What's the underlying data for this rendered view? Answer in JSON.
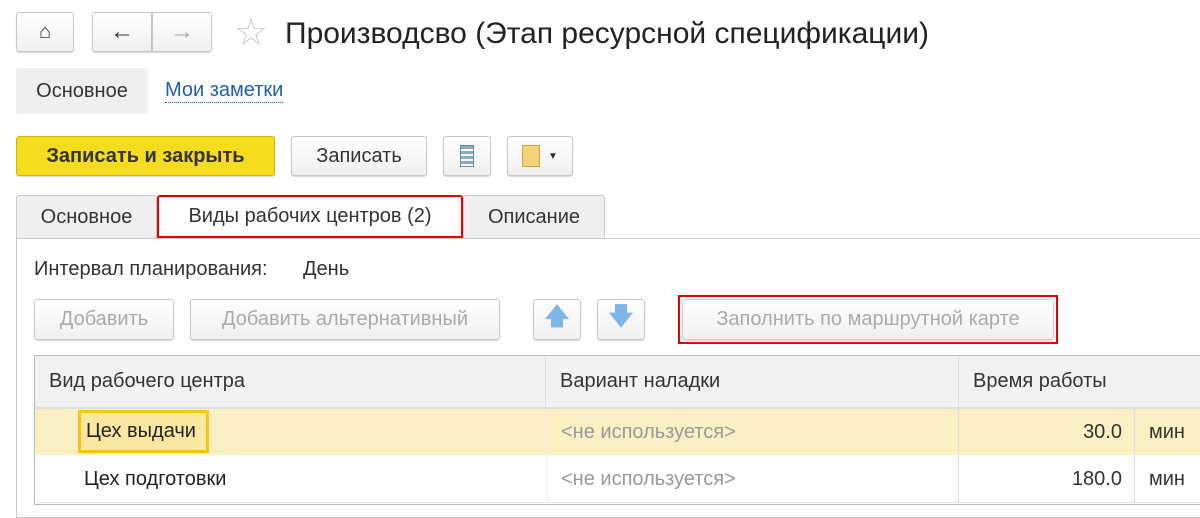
{
  "header": {
    "title": "Производсво (Этап ресурсной спецификации)"
  },
  "nav": {
    "main": "Основное",
    "notes": "Мои заметки"
  },
  "toolbar": {
    "save_close": "Записать и закрыть",
    "save": "Записать"
  },
  "tabs": [
    {
      "label": "Основное"
    },
    {
      "label": "Виды рабочих центров (2)"
    },
    {
      "label": "Описание"
    }
  ],
  "panel": {
    "interval_label": "Интервал планирования:",
    "interval_value": "День",
    "add": "Добавить",
    "add_alt": "Добавить альтернативный",
    "fill": "Заполнить по маршрутной карте"
  },
  "table": {
    "headers": [
      "Вид рабочего центра",
      "Вариант наладки",
      "Время работы"
    ],
    "rows": [
      {
        "name": "Цех выдачи",
        "variant": "<не используется>",
        "time": "30.0",
        "unit": "мин"
      },
      {
        "name": "Цех подготовки",
        "variant": "<не используется>",
        "time": "180.0",
        "unit": "мин"
      }
    ]
  },
  "colors": {
    "accent": "#f5dc1e",
    "highlight": "#e60000",
    "selected_row": "#fbefc4"
  }
}
